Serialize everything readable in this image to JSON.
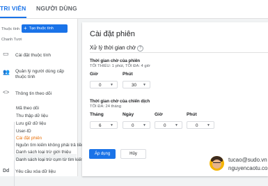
{
  "tabs": {
    "active": "TRI VIÊN",
    "other": "NGƯỜI DÙNG"
  },
  "sidebar": {
    "account_label": "Thuộc tính",
    "create_button": "Tạo thuộc tính",
    "account_name": "Chanh Tươi",
    "items": [
      {
        "label": "Cài đặt thuộc tính",
        "icon": "property-settings-icon"
      },
      {
        "label": "Quản lý người dùng cấp thuộc tính",
        "icon": "users-icon"
      },
      {
        "label": "Thông tin theo dõi",
        "icon": "code-icon"
      }
    ],
    "subitems": [
      "Mã theo dõi",
      "Thu thập dữ liệu",
      "Lưu giữ dữ liệu",
      "User-ID",
      "Cài đặt phiên",
      "Nguồn tìm kiếm không phải trả tiền",
      "Danh sách loại trừ giới thiệu",
      "Danh sách loại trừ cụm từ tìm kiếm",
      "Yêu cầu xóa dữ liệu"
    ],
    "bottom_item": {
      "label": "Yêu cầu xóa dữ liệu",
      "icon": "Dd"
    },
    "active_subitem": "Cài đặt phiên"
  },
  "main": {
    "title": "Cài đặt phiên",
    "section_title": "Xử lý thời gian chờ",
    "help_icon": "?",
    "session_timeout": {
      "label": "Thời gian chờ của phiên",
      "hint": "TỐI THIỂU: 1 phút, TỐI ĐA: 4 giờ",
      "hours_label": "Giờ",
      "hours_value": "0",
      "minutes_label": "Phút",
      "minutes_value": "30"
    },
    "campaign_timeout": {
      "label": "Thời gian chờ của chiến dịch",
      "hint": "TỐI ĐA: 24 tháng",
      "months_label": "Tháng",
      "months_value": "6",
      "days_label": "Ngày",
      "days_value": "0",
      "hours_label": "Giờ",
      "hours_value": "0",
      "minutes_label": "Phút",
      "minutes_value": "0"
    },
    "apply_button": "Áp dụng",
    "cancel_button": "Hủy"
  },
  "watermark": {
    "line1": "tucao@sudo.vn",
    "line2": "nguyencaotu.com"
  }
}
